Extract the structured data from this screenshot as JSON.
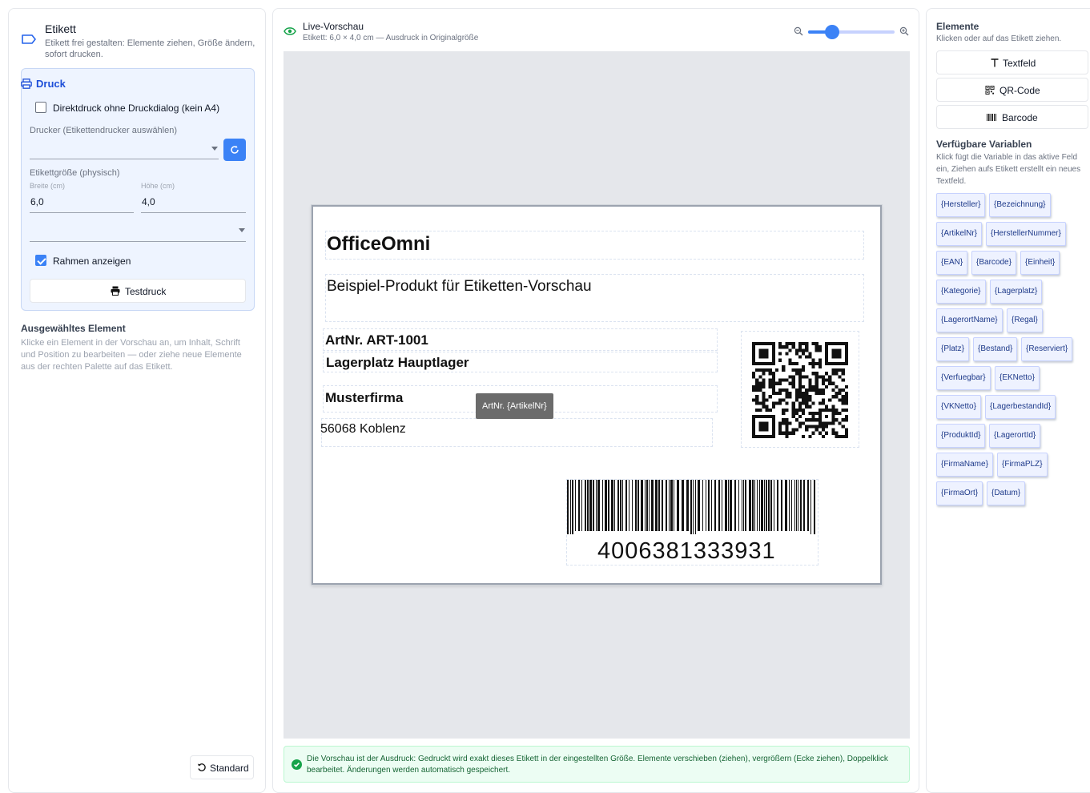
{
  "left": {
    "title": "Etikett",
    "subtitle": "Etikett frei gestalten: Elemente ziehen, Größe ändern, sofort drucken.",
    "druck": {
      "title": "Druck",
      "direct_print_label": "Direktdruck ohne Druckdialog (kein A4)",
      "direct_print_checked": false,
      "printer_label": "Drucker (Etikettendrucker auswählen)",
      "printer_value": "",
      "size_label": "Etikettgröße (physisch)",
      "width_label": "Breite (cm)",
      "width_value": "6,0",
      "height_label": "Höhe (cm)",
      "height_value": "4,0",
      "preset_value": "",
      "frame_label": "Rahmen anzeigen",
      "frame_checked": true,
      "test_print_label": "Testdruck"
    },
    "selected": {
      "title": "Ausgewähltes Element",
      "hint": "Klicke ein Element in der Vorschau an, um Inhalt, Schrift und Position zu bearbeiten — oder ziehe neue Elemente aus der rechten Palette auf das Etikett."
    },
    "reset_label": "Standard"
  },
  "preview": {
    "title": "Live-Vorschau",
    "subtitle": "Etikett: 6,0 × 4,0 cm — Ausdruck in Originalgröße",
    "zoom_level": 0.28,
    "label": {
      "company": "OfficeOmni",
      "bezeichnung": "Beispiel-Produkt für Etiketten-Vorschau",
      "artnr": "ArtNr. ART-1001",
      "lagerplatz": "Lagerplatz Hauptlager",
      "firma": "Musterfirma",
      "ort": "56068 Koblenz",
      "ean": "4006381333931"
    },
    "tooltip": "ArtNr. {ArtikelNr}",
    "info": "Die Vorschau ist der Ausdruck: Gedruckt wird exakt dieses Etikett in der eingestellten Größe. Elemente verschieben (ziehen), vergrößern (Ecke ziehen), Doppelklick bearbeitet. Änderungen werden automatisch gespeichert."
  },
  "right": {
    "title": "Elemente",
    "subtitle": "Klicken oder auf das Etikett ziehen.",
    "buttons": {
      "text": "Textfeld",
      "qr": "QR-Code",
      "barcode": "Barcode"
    },
    "vars_title": "Verfügbare Variablen",
    "vars_hint": "Klick fügt die Variable in das aktive Feld ein, Ziehen aufs Etikett erstellt ein neues Textfeld.",
    "variables": [
      "{Hersteller}",
      "{Bezeichnung}",
      "{ArtikelNr}",
      "{HerstellerNummer}",
      "{EAN}",
      "{Barcode}",
      "{Einheit}",
      "{Kategorie}",
      "{Lagerplatz}",
      "{LagerortName}",
      "{Regal}",
      "{Platz}",
      "{Bestand}",
      "{Reserviert}",
      "{Verfuegbar}",
      "{EKNetto}",
      "{VKNetto}",
      "{LagerbestandId}",
      "{ProduktId}",
      "{LagerortId}",
      "{FirmaName}",
      "{FirmaPLZ}",
      "{FirmaOrt}",
      "{Datum}"
    ]
  },
  "colors": {
    "accent": "#3b82f6",
    "success": "#16a34a"
  }
}
